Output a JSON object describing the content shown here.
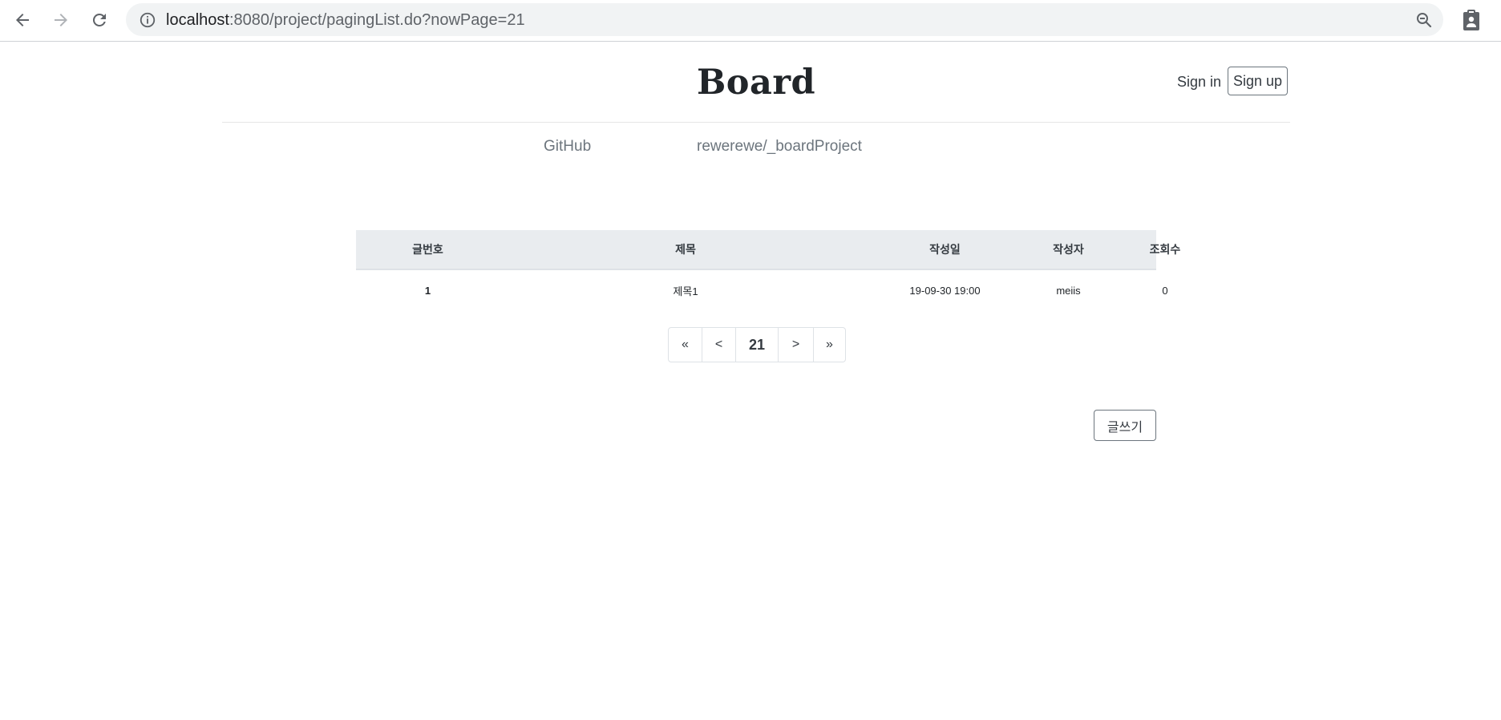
{
  "browser": {
    "url_host": "localhost",
    "url_rest": ":8080/project/pagingList.do?nowPage=21",
    "icons": [
      "back-arrow-icon",
      "forward-arrow-icon",
      "reload-icon",
      "info-icon",
      "zoom-icon",
      "clipboard-icon"
    ]
  },
  "header": {
    "title": "Board",
    "sign_in": "Sign in",
    "sign_up": "Sign up"
  },
  "subnav": {
    "items": [
      "GitHub",
      "rewerewe/_boardProject"
    ]
  },
  "table": {
    "columns": [
      "글번호",
      "제목",
      "작성일",
      "작성자",
      "조회수"
    ],
    "rows": [
      [
        "1",
        "제목1",
        "19-09-30 19:00",
        "meiis",
        "0"
      ]
    ]
  },
  "pagination": {
    "first": "«",
    "prev": "<",
    "current": "21",
    "next": ">",
    "last": "»"
  },
  "write_button": "글쓰기",
  "colors": {
    "header_bg": "#e9ecef",
    "omnibox_bg": "#f1f3f4",
    "text": "#212529",
    "muted": "#6c757d"
  }
}
